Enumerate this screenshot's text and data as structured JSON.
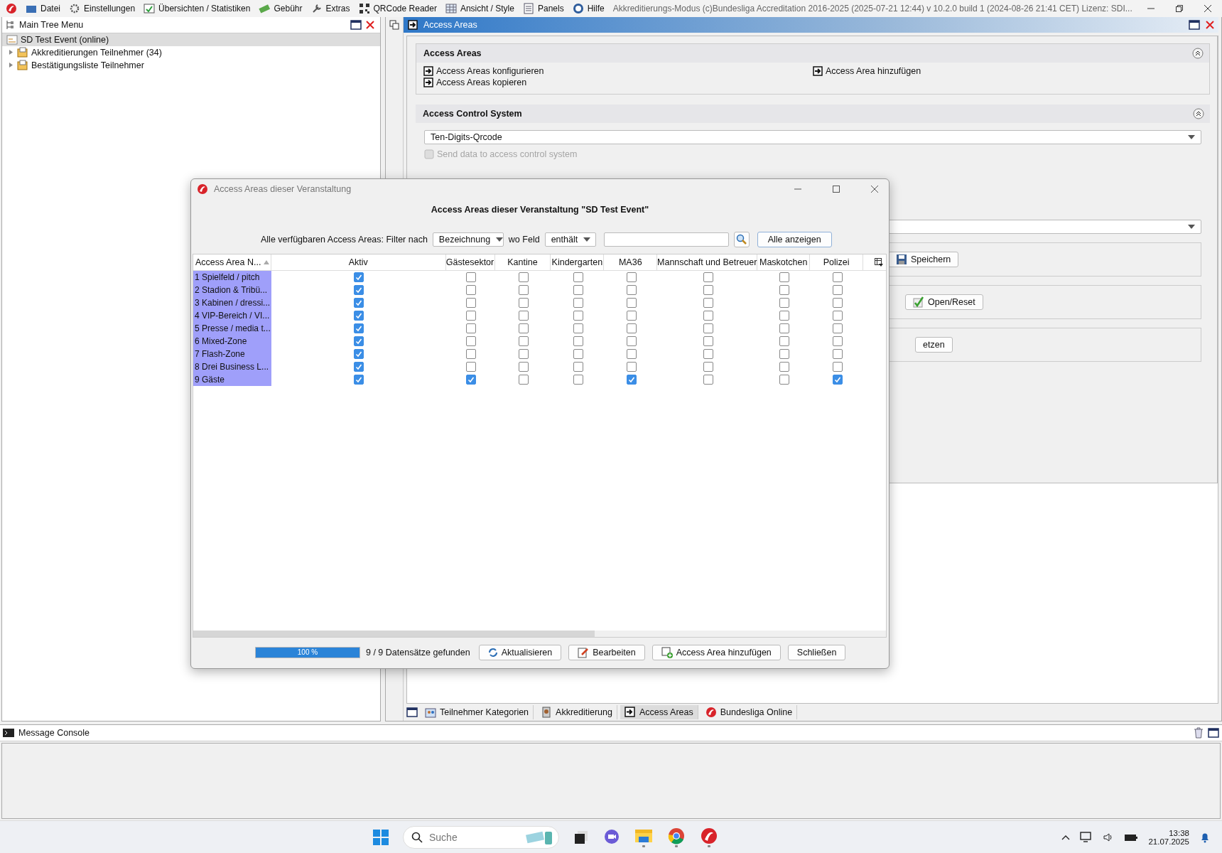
{
  "menu_bar": {
    "items": [
      "Datei",
      "Einstellungen",
      "Übersichten / Statistiken",
      "Gebühr",
      "Extras",
      "QRCode Reader",
      "Ansicht / Style",
      "Panels",
      "Hilfe"
    ],
    "title_info": "Akkreditierungs-Modus (c)Bundesliga Accreditation 2016-2025 (2025-07-21 12:44) v 10.2.0 build 1 (2024-08-26 21:41 CET) Lizenz: SDI..."
  },
  "left_panel": {
    "title": "Main Tree Menu",
    "tree": [
      {
        "label": "SD Test Event (online)",
        "selected": true,
        "children": [
          {
            "label": "Akkreditierungen Teilnehmer (34)",
            "selected": false,
            "expanded": false
          },
          {
            "label": "Bestätigungsliste Teilnehmer",
            "selected": false,
            "expanded": false
          }
        ]
      }
    ]
  },
  "right_panel": {
    "title": "Access Areas",
    "access_areas_section": {
      "title": "Access Areas",
      "links": [
        "Access Areas konfigurieren",
        "Access Areas kopieren",
        "Access Area hinzufügen"
      ]
    },
    "access_control_section": {
      "title": "Access Control System",
      "system": "Ten-Digits-Qrcode",
      "send_data": {
        "label": "Send data to access control system",
        "disabled": true
      },
      "save_button": "Speichern",
      "open_reset_button": "Open/Reset",
      "reset_button_part": "etzen"
    },
    "bottom_tabs": [
      {
        "label": "Teilnehmer Kategorien",
        "selected": false,
        "kind": "people"
      },
      {
        "label": "Akkreditierung",
        "selected": false,
        "kind": "badge"
      },
      {
        "label": "Access Areas",
        "selected": true,
        "kind": "enter"
      },
      {
        "label": "Bundesliga Online",
        "selected": false,
        "kind": "logo"
      }
    ]
  },
  "console": {
    "title": "Message Console"
  },
  "dialog": {
    "title": "Access Areas dieser Veranstaltung",
    "heading": "Access Areas dieser Veranstaltung \"SD Test Event\"",
    "filter": {
      "label": "Alle verfügbaren Access Areas: Filter nach",
      "field": "Bezeichnung",
      "where_label": "wo Feld",
      "operator": "enthält",
      "show_all": "Alle anzeigen"
    },
    "table": {
      "columns": [
        "Access Area N...",
        "Aktiv",
        "Gästesektor",
        "Kantine",
        "Kindergarten",
        "MA36",
        "Mannschaft und Betreuer",
        "Maskotchen",
        "Polizei"
      ],
      "rows": [
        {
          "name": "1 Spielfeld / pitch",
          "selected": true,
          "checks": [
            true,
            false,
            false,
            false,
            false,
            false,
            false,
            false
          ]
        },
        {
          "name": "2 Stadion & Tribü...",
          "selected": true,
          "checks": [
            true,
            false,
            false,
            false,
            false,
            false,
            false,
            false
          ]
        },
        {
          "name": "3 Kabinen / dressi...",
          "selected": true,
          "checks": [
            true,
            false,
            false,
            false,
            false,
            false,
            false,
            false
          ]
        },
        {
          "name": "4 VIP-Bereich / VI...",
          "selected": true,
          "checks": [
            true,
            false,
            false,
            false,
            false,
            false,
            false,
            false
          ]
        },
        {
          "name": "5 Presse / media t...",
          "selected": true,
          "checks": [
            true,
            false,
            false,
            false,
            false,
            false,
            false,
            false
          ]
        },
        {
          "name": "6 Mixed-Zone",
          "selected": true,
          "checks": [
            true,
            false,
            false,
            false,
            false,
            false,
            false,
            false
          ]
        },
        {
          "name": "7 Flash-Zone",
          "selected": true,
          "checks": [
            true,
            false,
            false,
            false,
            false,
            false,
            false,
            false
          ]
        },
        {
          "name": "8 Drei Business L...",
          "selected": true,
          "checks": [
            true,
            false,
            false,
            false,
            false,
            false,
            false,
            false
          ]
        },
        {
          "name": "9 Gäste",
          "selected": true,
          "checks": [
            true,
            true,
            false,
            false,
            true,
            false,
            false,
            true
          ]
        }
      ]
    },
    "progress": {
      "level": 1,
      "label": "100 %"
    },
    "status": "9 / 9 Datensätze gefunden",
    "buttons": [
      {
        "label": "Aktualisieren",
        "kind": "refresh"
      },
      {
        "label": "Bearbeiten",
        "kind": "edit"
      },
      {
        "label": "Access Area hinzufügen",
        "kind": "add"
      },
      {
        "label": "Schließen",
        "kind": "plain"
      }
    ]
  },
  "taskbar": {
    "search_placeholder": "Suche",
    "time": "13:38",
    "date": "21.07.2025"
  }
}
